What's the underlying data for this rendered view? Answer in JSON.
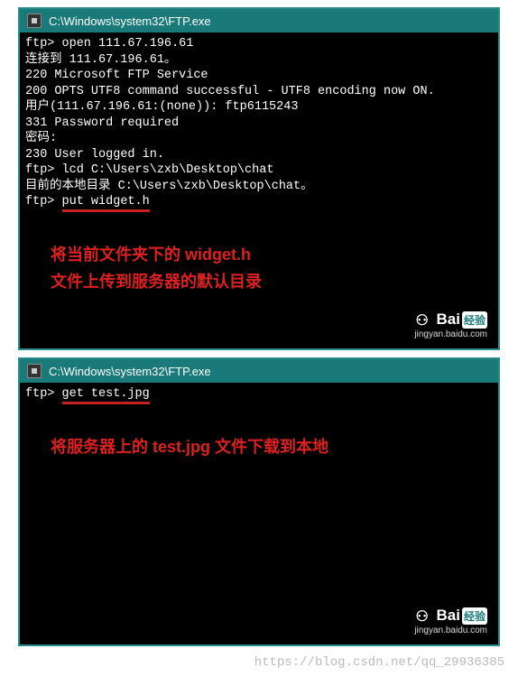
{
  "window1": {
    "title": "C:\\Windows\\system32\\FTP.exe",
    "lines": [
      "ftp> open 111.67.196.61",
      "连接到 111.67.196.61。",
      "220 Microsoft FTP Service",
      "200 OPTS UTF8 command successful - UTF8 encoding now ON.",
      "用户(111.67.196.61:(none)): ftp6115243",
      "331 Password required",
      "密码:",
      "230 User logged in.",
      "ftp> lcd C:\\Users\\zxb\\Desktop\\chat",
      "目前的本地目录 C:\\Users\\zxb\\Desktop\\chat。"
    ],
    "highlight_prefix": "ftp> ",
    "highlight_cmd": "put widget.h",
    "annotation_l1": "将当前文件夹下的 widget.h",
    "annotation_l2": "文件上传到服务器的默认目录"
  },
  "window2": {
    "title": "C:\\Windows\\system32\\FTP.exe",
    "highlight_prefix": "ftp> ",
    "highlight_cmd": "get test.jpg",
    "annotation": "将服务器上的 test.jpg 文件下载到本地"
  },
  "watermark": {
    "brand_text": "Bai",
    "brand_suffix": "经验",
    "brand_url": "jingyan.baidu.com"
  },
  "page_watermark": "https://blog.csdn.net/qq_29936385"
}
